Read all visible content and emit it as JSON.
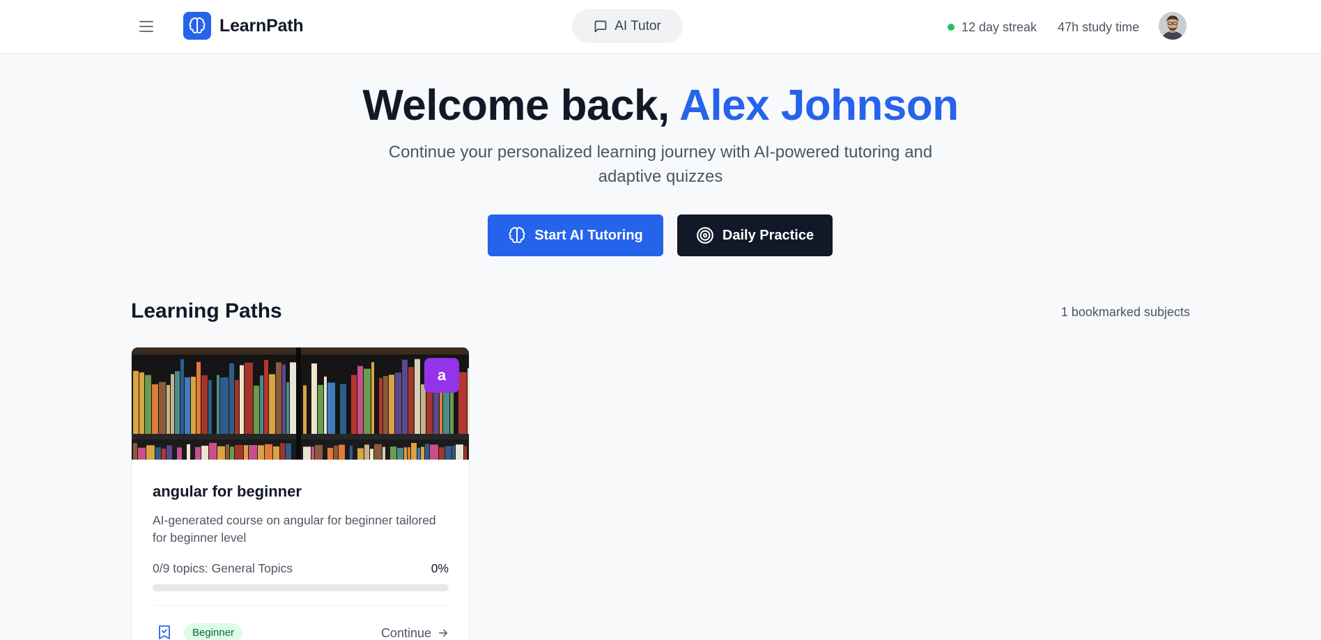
{
  "app": {
    "name": "LearnPath"
  },
  "header": {
    "ai_tutor_label": "AI Tutor",
    "streak": "12 day streak",
    "study_time": "47h study time",
    "icons": [
      "menu-icon",
      "brain-icon",
      "chat-icon",
      "avatar"
    ]
  },
  "hero": {
    "greeting": "Welcome back, ",
    "user_name": "Alex Johnson",
    "subtitle": "Continue your personalized learning journey with AI-powered tutoring and adaptive quizzes",
    "primary_button": "Start AI Tutoring",
    "secondary_button": "Daily Practice"
  },
  "learning_paths": {
    "title": "Learning Paths",
    "bookmark_count": "1 bookmarked subjects",
    "cards": [
      {
        "badge": "a",
        "title": "angular for beginner",
        "description": "AI-generated course on angular for beginner tailored for beginner level",
        "progress_label": "0/9 topics: General Topics",
        "progress_percent_text": "0%",
        "progress_fraction": 0,
        "level": "Beginner",
        "continue_label": "Continue"
      }
    ]
  },
  "colors": {
    "accent": "#2563eb",
    "dark": "#111827",
    "streak_dot": "#22c55e",
    "badge_purple": "#9333ea",
    "level_bg": "#dcfce7",
    "level_text": "#166534"
  }
}
